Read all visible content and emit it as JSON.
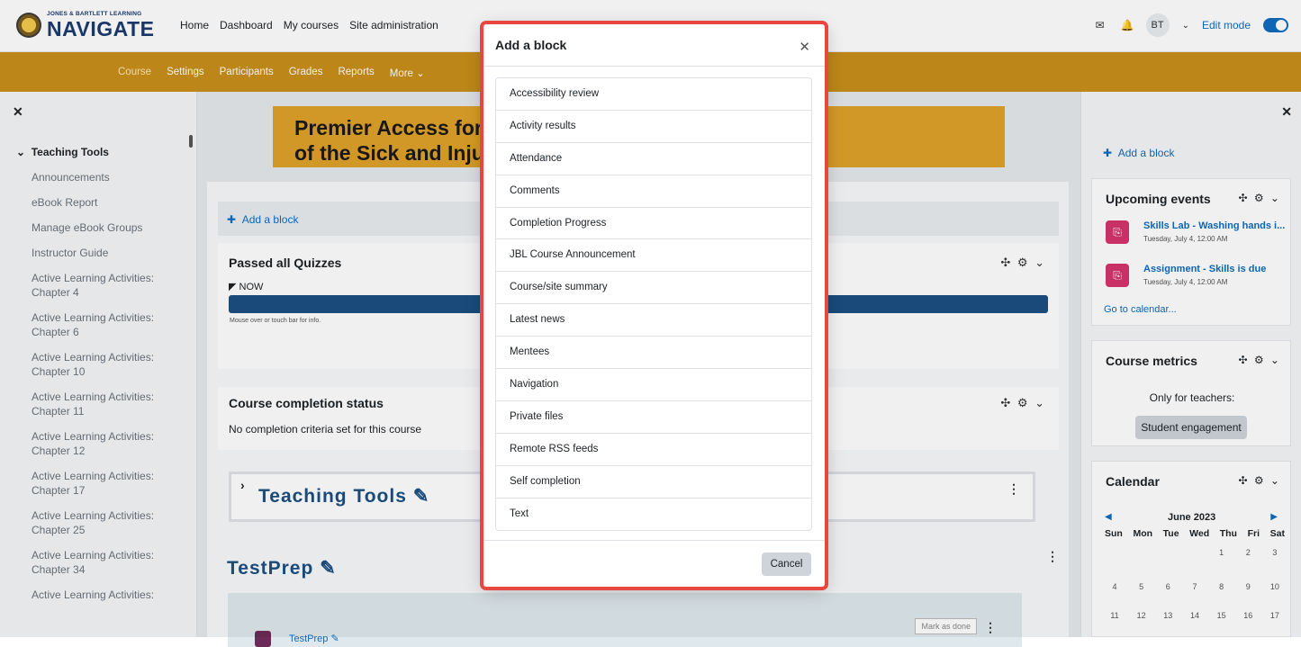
{
  "brand": {
    "small": "JONES & BARTLETT LEARNING",
    "big": "NAVIGATE"
  },
  "topnav": [
    "Home",
    "Dashboard",
    "My courses",
    "Site administration"
  ],
  "user": {
    "initials": "BT",
    "edit_mode": "Edit mode"
  },
  "secnav": {
    "active": "Course",
    "items": [
      "Settings",
      "Participants",
      "Grades",
      "Reports",
      "More"
    ]
  },
  "left_drawer": {
    "heading": "Teaching Tools",
    "items": [
      "Announcements",
      "eBook Report",
      "Manage eBook Groups",
      "Instructor Guide",
      "Active Learning Activities: Chapter 4",
      "Active Learning Activities: Chapter 6",
      "Active Learning Activities: Chapter 10",
      "Active Learning Activities: Chapter 11",
      "Active Learning Activities: Chapter 12",
      "Active Learning Activities: Chapter 17",
      "Active Learning Activities: Chapter 25",
      "Active Learning Activities: Chapter 34",
      "Active Learning Activities:"
    ]
  },
  "main": {
    "banner_line1": "Premier Access for Er",
    "banner_line2": "of the Sick and Injured",
    "add_block": "Add a block",
    "quizzes_title": "Passed all Quizzes",
    "now": "NOW",
    "mouseover": "Mouse over or touch bar for info.",
    "completion_title": "Course completion status",
    "completion_text": "No completion criteria set for this course",
    "section1": "Teaching Tools",
    "section2": "TestPrep",
    "activity": "TestPrep",
    "mark_done": "Mark as done"
  },
  "right_drawer": {
    "add_block": "Add a block",
    "upcoming_title": "Upcoming events",
    "events": [
      {
        "title": "Skills Lab - Washing hands i...",
        "date": "Tuesday, July 4, 12:00 AM"
      },
      {
        "title": "Assignment - Skills is due",
        "date": "Tuesday, July 4, 12:00 AM"
      }
    ],
    "go_calendar": "Go to calendar...",
    "metrics_title": "Course metrics",
    "metrics_note": "Only for teachers:",
    "engagement": "Student engagement",
    "calendar_title": "Calendar",
    "month": "June 2023",
    "days": [
      "Sun",
      "Mon",
      "Tue",
      "Wed",
      "Thu",
      "Fri",
      "Sat"
    ],
    "weeks": [
      [
        "",
        "",
        "",
        "",
        "1",
        "2",
        "3"
      ],
      [
        "4",
        "5",
        "6",
        "7",
        "8",
        "9",
        "10"
      ],
      [
        "11",
        "12",
        "13",
        "14",
        "15",
        "16",
        "17"
      ]
    ]
  },
  "modal": {
    "title": "Add a block",
    "blocks": [
      "Accessibility review",
      "Activity results",
      "Attendance",
      "Comments",
      "Completion Progress",
      "JBL Course Announcement",
      "Course/site summary",
      "Latest news",
      "Mentees",
      "Navigation",
      "Private files",
      "Remote RSS feeds",
      "Self completion",
      "Text"
    ],
    "cancel": "Cancel"
  }
}
